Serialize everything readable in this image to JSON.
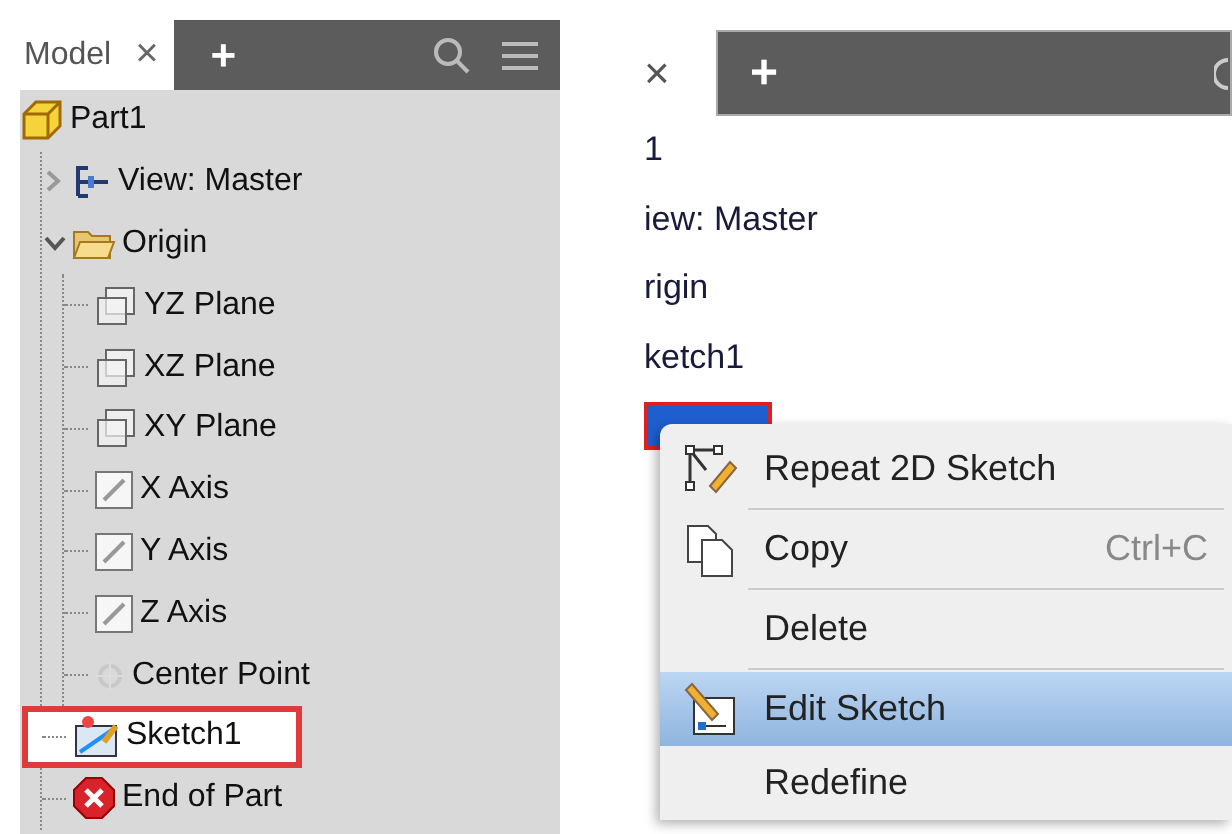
{
  "left_panel": {
    "tab": {
      "label": "Model",
      "close": "×"
    },
    "add": "+",
    "tree": [
      {
        "label": "Part1",
        "kind": "part",
        "selected": false,
        "children": [
          {
            "label": "View: Master",
            "kind": "view",
            "selected": false,
            "expanded": false
          },
          {
            "label": "Origin",
            "kind": "folder",
            "selected": false,
            "expanded": true,
            "children": [
              {
                "label": "YZ Plane",
                "kind": "plane",
                "selected": false
              },
              {
                "label": "XZ Plane",
                "kind": "plane",
                "selected": false
              },
              {
                "label": "XY Plane",
                "kind": "plane",
                "selected": false
              },
              {
                "label": "X Axis",
                "kind": "axis",
                "selected": false
              },
              {
                "label": "Y Axis",
                "kind": "axis",
                "selected": false
              },
              {
                "label": "Z Axis",
                "kind": "axis",
                "selected": false
              },
              {
                "label": "Center Point",
                "kind": "point",
                "selected": false
              }
            ]
          },
          {
            "label": "Sketch1",
            "kind": "sketch",
            "selected": true,
            "highlighted": true
          },
          {
            "label": "End of Part",
            "kind": "end",
            "selected": false
          }
        ]
      }
    ]
  },
  "right_panel": {
    "tab": {
      "close": "×"
    },
    "add": "+",
    "items": [
      {
        "label": "1",
        "selected": false
      },
      {
        "label": "iew: Master",
        "selected": false
      },
      {
        "label": "rigin",
        "selected": false
      },
      {
        "label": "ketch1",
        "selected": false
      },
      {
        "selected": true,
        "highlighted": true
      }
    ],
    "context_menu": [
      {
        "label": "Repeat 2D Sketch",
        "kind": "repeat",
        "highlighted": false,
        "separator_after": true
      },
      {
        "label": "Copy",
        "kind": "copy",
        "shortcut": "Ctrl+C",
        "highlighted": false,
        "separator_after": true
      },
      {
        "label": "Delete",
        "kind": "plain",
        "highlighted": false,
        "separator_after": true
      },
      {
        "label": "Edit Sketch",
        "kind": "edit",
        "highlighted": true,
        "separator_after": false
      },
      {
        "label": "Redefine",
        "kind": "plain",
        "highlighted": false,
        "separator_after": false
      }
    ]
  }
}
